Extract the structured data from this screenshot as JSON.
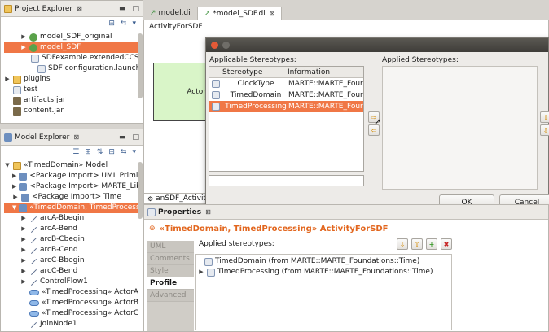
{
  "project_explorer": {
    "title": "Project Explorer",
    "close": "⊠",
    "items": [
      {
        "label": "model_SDF_original",
        "indent": 2,
        "arrow": "▶",
        "icon": "proj"
      },
      {
        "label": "model_SDF",
        "indent": 2,
        "arrow": "▶",
        "icon": "proj",
        "selected": true
      },
      {
        "label": "SDFexample.extendedCCSL",
        "indent": 3,
        "arrow": "",
        "icon": "file"
      },
      {
        "label": "SDF configuration.launch",
        "indent": 3,
        "arrow": "",
        "icon": "file"
      },
      {
        "label": "plugins",
        "indent": 0,
        "arrow": "▶",
        "icon": "folder"
      },
      {
        "label": "test",
        "indent": 0,
        "arrow": "",
        "icon": "file"
      },
      {
        "label": "artifacts.jar",
        "indent": 0,
        "arrow": "",
        "icon": "jar"
      },
      {
        "label": "content.jar",
        "indent": 0,
        "arrow": "",
        "icon": "jar"
      }
    ]
  },
  "model_explorer": {
    "title": "Model Explorer",
    "close": "⊠",
    "items": [
      {
        "label": "«TimedDomain» Model",
        "indent": 0,
        "arrow": "▼",
        "icon": "folder"
      },
      {
        "label": "<Package Import> UML Primitiv",
        "indent": 1,
        "arrow": "▶",
        "icon": "pkg"
      },
      {
        "label": "<Package Import> MARTE_Libra",
        "indent": 1,
        "arrow": "▶",
        "icon": "pkg"
      },
      {
        "label": "<Package Import> Time",
        "indent": 1,
        "arrow": "▶",
        "icon": "pkg"
      },
      {
        "label": "«TimedDomain, TimedProcessin",
        "indent": 1,
        "arrow": "▼",
        "icon": "pkg",
        "selected": true
      },
      {
        "label": "arcA-Bbegin",
        "indent": 2,
        "arrow": "▶",
        "icon": "edge"
      },
      {
        "label": "arcA-Bend",
        "indent": 2,
        "arrow": "▶",
        "icon": "edge"
      },
      {
        "label": "arcB-Cbegin",
        "indent": 2,
        "arrow": "▶",
        "icon": "edge"
      },
      {
        "label": "arcB-Cend",
        "indent": 2,
        "arrow": "▶",
        "icon": "edge"
      },
      {
        "label": "arcC-Bbegin",
        "indent": 2,
        "arrow": "▶",
        "icon": "edge"
      },
      {
        "label": "arcC-Bend",
        "indent": 2,
        "arrow": "▶",
        "icon": "edge"
      },
      {
        "label": "ControlFlow1",
        "indent": 2,
        "arrow": "▶",
        "icon": "edge"
      },
      {
        "label": "«TimedProcessing» ActorA",
        "indent": 2,
        "arrow": "",
        "icon": "oval"
      },
      {
        "label": "«TimedProcessing» ActorB",
        "indent": 2,
        "arrow": "",
        "icon": "oval"
      },
      {
        "label": "«TimedProcessing» ActorC",
        "indent": 2,
        "arrow": "",
        "icon": "oval"
      },
      {
        "label": "JoinNode1",
        "indent": 2,
        "arrow": "",
        "icon": "edge"
      }
    ]
  },
  "editor": {
    "tabs": [
      {
        "label": "model.di",
        "active": false
      },
      {
        "label": "*model_SDF.di",
        "active": true
      }
    ],
    "tab_close": "⊠",
    "diagram_title": "ActivityForSDF",
    "actor_label": "Actor",
    "bottom_tab": "anSDF_Activity"
  },
  "dialog": {
    "applicable_label": "Applicable Stereotypes:",
    "applied_label": "Applied Stereotypes:",
    "columns": [
      "Stereotype",
      "Information"
    ],
    "rows": [
      {
        "stereotype": "ClockType",
        "info": "MARTE::MARTE_Four",
        "selected": false
      },
      {
        "stereotype": "TimedDomain",
        "info": "MARTE::MARTE_Four",
        "selected": false
      },
      {
        "stereotype": "TimedProcessing",
        "info": "MARTE::MARTE_Four",
        "selected": true
      }
    ],
    "ok": "OK",
    "cancel": "Cancel"
  },
  "properties": {
    "title": "Properties",
    "close": "⊠",
    "heading": "«TimedDomain, TimedProcessing» ActivityForSDF",
    "side_tabs": [
      "UML",
      "Comments",
      "Style",
      "Profile",
      "Advanced"
    ],
    "active_tab": "Profile",
    "applied_label": "Applied stereotypes:",
    "applied": [
      "TimedDomain  (from MARTE::MARTE_Foundations::Time)",
      "TimedProcessing  (from MARTE::MARTE_Foundations::Time)"
    ]
  },
  "colors": {
    "selection": "#f07746",
    "heading": "#e2661e",
    "actor_fill": "#d9f5c8"
  }
}
